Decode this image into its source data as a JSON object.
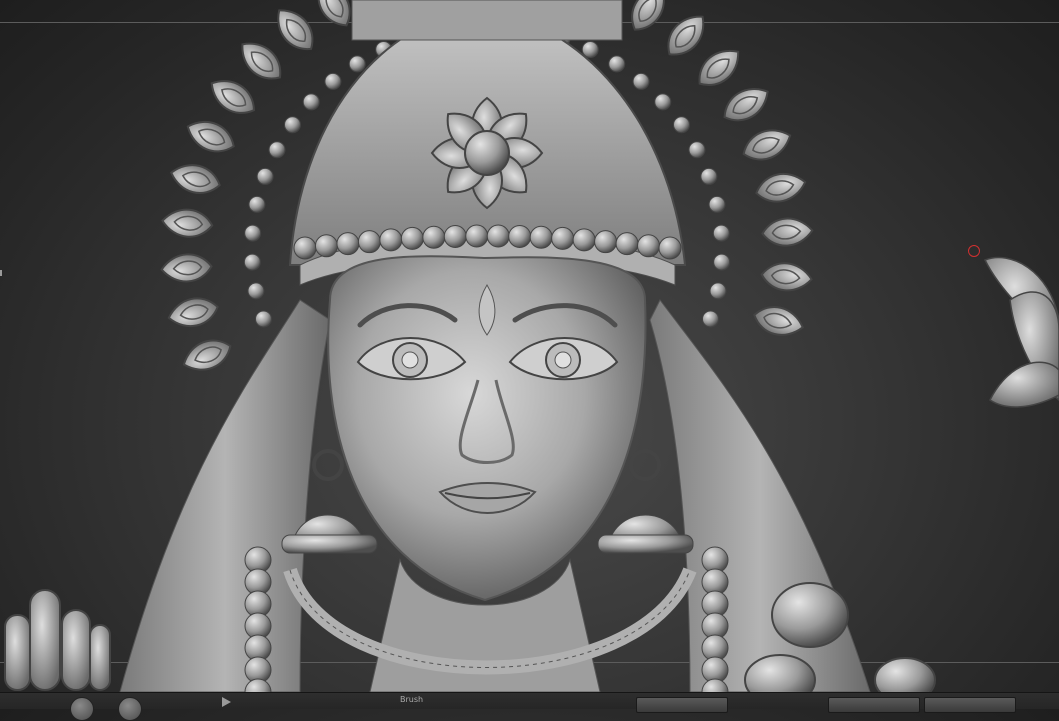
{
  "canvas": {
    "background": "#2b2b2b",
    "model_fill": "#9c9c9c",
    "model_highlight": "#d6d6d6",
    "model_shadow": "#4a4a4a",
    "cursor_color": "#d23030",
    "subject": "sculpted-deity-bust-3d-model"
  },
  "bottom_shelf": {
    "partial_label": "Brush"
  }
}
